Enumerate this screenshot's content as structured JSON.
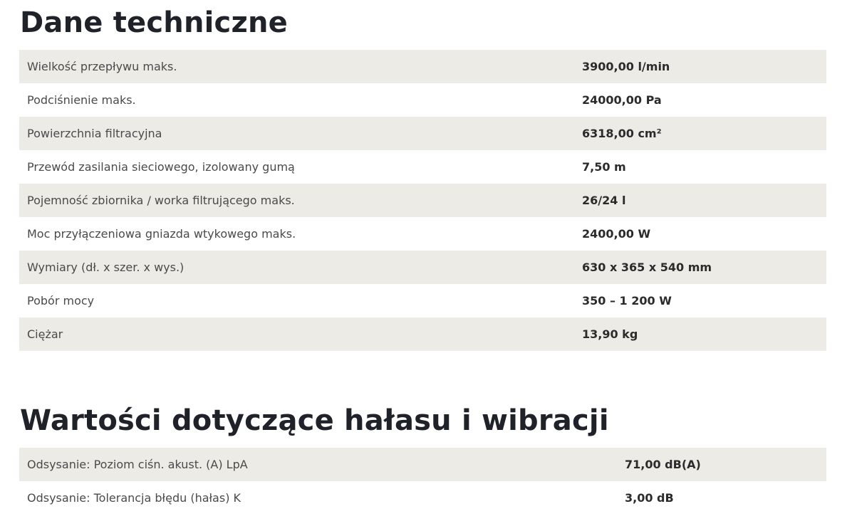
{
  "sections": {
    "technical": {
      "title": "Dane techniczne",
      "rows": [
        {
          "label": "Wielkość przepływu maks.",
          "value": "3900,00 l/min"
        },
        {
          "label": "Podciśnienie maks.",
          "value": "24000,00 Pa"
        },
        {
          "label": "Powierzchnia filtracyjna",
          "value": "6318,00 cm²"
        },
        {
          "label": "Przewód zasilania sieciowego, izolowany gumą",
          "value": "7,50 m"
        },
        {
          "label": "Pojemność zbiornika / worka filtrującego maks.",
          "value": "26/24 l"
        },
        {
          "label": "Moc przyłączeniowa gniazda wtykowego maks.",
          "value": "2400,00 W"
        },
        {
          "label": "Wymiary (dł. x szer. x wys.)",
          "value": "630 x 365 x 540 mm"
        },
        {
          "label": "Pobór mocy",
          "value": "350 – 1 200 W"
        },
        {
          "label": "Ciężar",
          "value": "13,90 kg"
        }
      ]
    },
    "noise": {
      "title": "Wartości dotyczące hałasu i wibracji",
      "rows": [
        {
          "label": "Odsysanie: Poziom ciśn. akust. (A) LpA",
          "value": "71,00 dB(A)"
        },
        {
          "label": "Odsysanie: Tolerancja błędu (hałas) K",
          "value": "3,00 dB"
        }
      ]
    }
  },
  "colors": {
    "title": "#1f2229",
    "row_alt_bg": "#edebe5",
    "row_bg": "#ffffff",
    "label_text": "#4a4a4a",
    "value_text": "#2b2b2b"
  }
}
